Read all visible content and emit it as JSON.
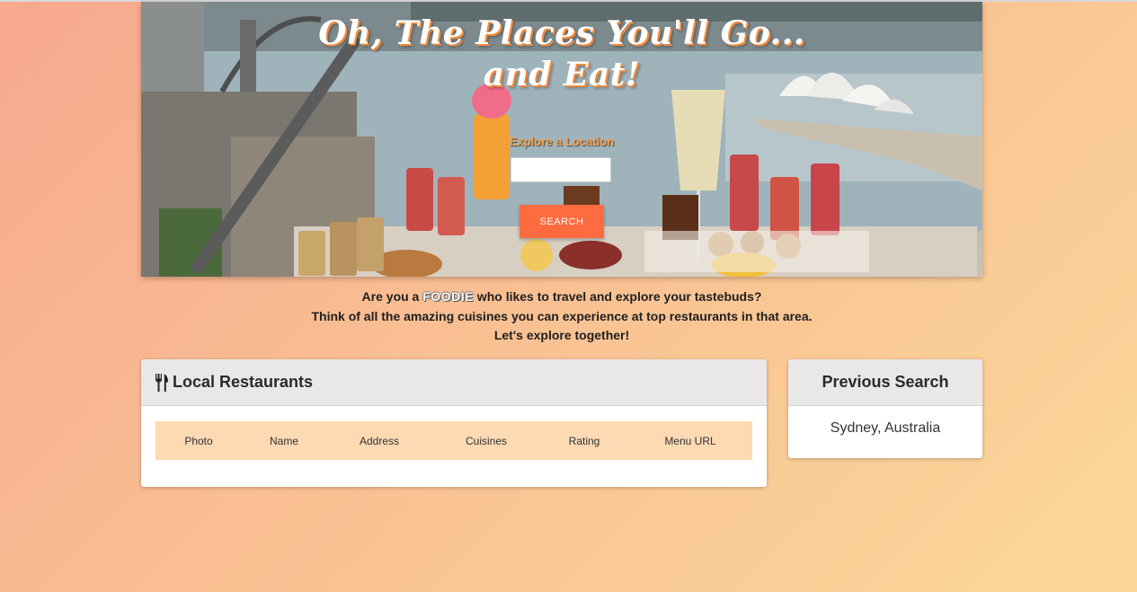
{
  "hero": {
    "title_line1": "Oh, The Places You'll Go...",
    "title_line2": "and Eat!",
    "explore_label": "Explore a Location",
    "search_value": "",
    "search_button_label": "SEARCH"
  },
  "intro": {
    "line1_prefix": "Are you a ",
    "line1_highlight": "FOODIE",
    "line1_suffix": " who likes to travel and explore your tastebuds?",
    "line2": "Think of all the amazing cuisines you can experience at top restaurants in that area.",
    "line3": "Let's explore together!"
  },
  "restaurants": {
    "icon": "utensils-icon",
    "title": "Local Restaurants",
    "columns": [
      "Photo",
      "Name",
      "Address",
      "Cuisines",
      "Rating",
      "Menu URL"
    ]
  },
  "previous_search": {
    "title": "Previous Search",
    "items": [
      "Sydney, Australia"
    ]
  },
  "colors": {
    "accent": "#ff6b40",
    "table_header": "#fdd9b4",
    "card_header": "#e9e7e8",
    "title_shadow": "#f08a3c"
  }
}
